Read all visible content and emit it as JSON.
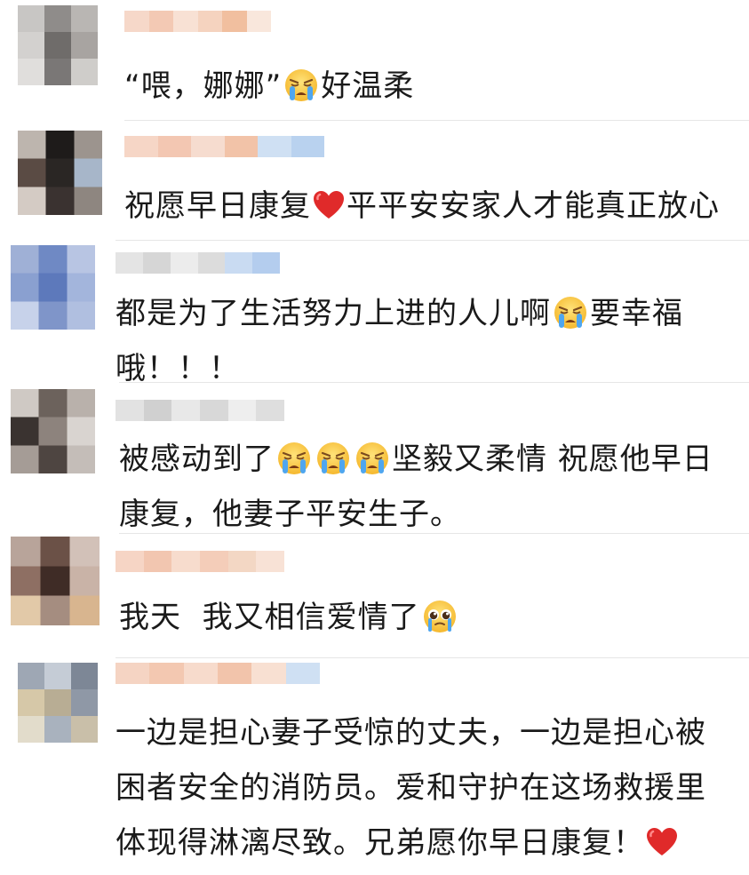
{
  "comments": [
    {
      "segments": [
        {
          "t": "text",
          "v": "“喂，娜娜”"
        },
        {
          "t": "emoji",
          "v": "crying-face"
        },
        {
          "t": "text",
          "v": "好温柔"
        }
      ],
      "avatar_colors": [
        "#c8c6c4",
        "#8f8c8a",
        "#b9b6b3",
        "#d3d1cf",
        "#6f6c6a",
        "#a8a4a1",
        "#e0dedc",
        "#7a7776",
        "#cfcdca"
      ],
      "name_colors": [
        "#f6d8c9",
        "#f3c9b4",
        "#f8e1d4",
        "#f5d3bf",
        "#f1bf9f",
        "#f9e7dc"
      ]
    },
    {
      "segments": [
        {
          "t": "text",
          "v": "祝愿早日康复"
        },
        {
          "t": "emoji",
          "v": "red-heart"
        },
        {
          "t": "text",
          "v": "平平安安家人才能真正放心"
        }
      ],
      "avatar_colors": [
        "#bdb5ae",
        "#1e1b1a",
        "#9c948e",
        "#5a4b44",
        "#2a2624",
        "#a7b6c9",
        "#d4cbc4",
        "#3a3230",
        "#8e8680"
      ],
      "name_colors": [
        "#f6d6c6",
        "#f3c7b2",
        "#f6dccf",
        "#f2c3a8",
        "#cfe0f3",
        "#b9d2ef"
      ]
    },
    {
      "segments": [
        {
          "t": "text",
          "v": "都是为了生活努力上进的人儿啊"
        },
        {
          "t": "emoji",
          "v": "crying-face"
        },
        {
          "t": "text",
          "v": "要幸福哦！！！"
        }
      ],
      "avatar_colors": [
        "#9fb0d6",
        "#6f89c4",
        "#b8c5e3",
        "#8aa0d0",
        "#5d79bb",
        "#a3b5dc",
        "#c7d2ea",
        "#7f95c9",
        "#b0bfe0"
      ],
      "name_colors": [
        "#e4e4e4",
        "#d6d6d6",
        "#ececec",
        "#dcdcdc",
        "#c9dbf2",
        "#b4cdee"
      ]
    },
    {
      "segments": [
        {
          "t": "text",
          "v": "被感动到了"
        },
        {
          "t": "emoji",
          "v": "crying-face"
        },
        {
          "t": "emoji",
          "v": "crying-face"
        },
        {
          "t": "emoji",
          "v": "crying-face"
        },
        {
          "t": "text",
          "v": "坚毅又柔情 祝愿他早日康复，他妻子平安生子。"
        }
      ],
      "avatar_colors": [
        "#cfc9c4",
        "#6c625c",
        "#b9b1ab",
        "#3a3330",
        "#8d837d",
        "#d9d4d0",
        "#a59c96",
        "#4e4541",
        "#c4bdb8"
      ],
      "name_colors": [
        "#e2e2e2",
        "#d0d0d0",
        "#e8e8e8",
        "#d8d8d8",
        "#eeeeee",
        "#dedede"
      ]
    },
    {
      "segments": [
        {
          "t": "text",
          "v": "我天  我又相信爱情了"
        },
        {
          "t": "emoji",
          "v": "pleading-face"
        }
      ],
      "avatar_colors": [
        "#b8a49a",
        "#6b5147",
        "#d2c1b8",
        "#8e6f63",
        "#3f2c26",
        "#c9b3a7",
        "#e2c9a8",
        "#a58d80",
        "#d8b58f"
      ],
      "name_colors": [
        "#f6d5c5",
        "#f2c6b0",
        "#f7dccd",
        "#f4cdb9",
        "#f3d7c4",
        "#f8e2d6"
      ]
    },
    {
      "segments": [
        {
          "t": "text",
          "v": "一边是担心妻子受惊的丈夫，一边是担心被困者安全的消防员。爱和守护在这场救援里体现得淋漓尽致。兄弟愿你早日康复！"
        },
        {
          "t": "emoji",
          "v": "red-heart"
        }
      ],
      "avatar_colors": [
        "#9ea7b4",
        "#c5ccd6",
        "#7d8796",
        "#d6c8a8",
        "#b8ad94",
        "#8f98a6",
        "#e2dccb",
        "#a9b2be",
        "#c9bfa9"
      ],
      "name_colors": [
        "#f5d4c3",
        "#f3c8b1",
        "#f7dbcc",
        "#f2c4ab",
        "#f8e0d2",
        "#cfe0f3"
      ]
    }
  ]
}
